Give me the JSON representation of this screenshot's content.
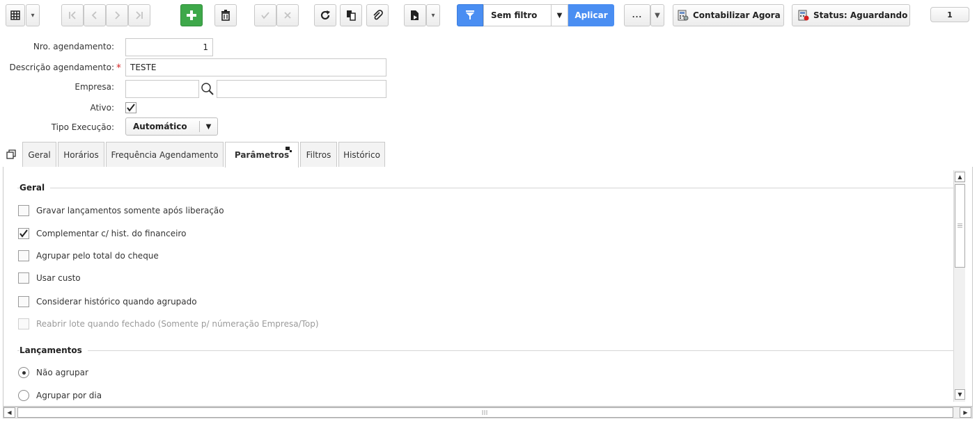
{
  "toolbar": {
    "filter_label": "Sem filtro",
    "apply_label": "Aplicar",
    "more_label": "...",
    "contabilizar_label": "Contabilizar Agora",
    "status_label": "Status: Aguardando",
    "page_number": "1",
    "icons": [
      "grid-icon",
      "first-icon",
      "prev-icon",
      "next-icon",
      "last-icon",
      "plus-icon",
      "trash-icon",
      "check-icon",
      "cancel-icon",
      "refresh-icon",
      "copy-icon",
      "attach-icon",
      "export-icon",
      "filter-icon"
    ]
  },
  "form": {
    "nro_label": "Nro. agendamento:",
    "nro_value": "1",
    "descricao_label": "Descrição agendamento:",
    "descricao_value": "TESTE",
    "empresa_label": "Empresa:",
    "empresa_code": "",
    "empresa_name": "",
    "ativo_label": "Ativo:",
    "ativo_checked": true,
    "tipo_label": "Tipo Execução:",
    "tipo_value": "Automático"
  },
  "tabs": [
    {
      "label": "Geral"
    },
    {
      "label": "Horários"
    },
    {
      "label": "Frequência Agendamento"
    },
    {
      "label": "Parâmetros",
      "active": true
    },
    {
      "label": "Filtros"
    },
    {
      "label": "Histórico"
    }
  ],
  "panel": {
    "geral_title": "Geral",
    "options": [
      {
        "label": "Gravar lançamentos somente após liberação",
        "checked": false,
        "enabled": true
      },
      {
        "label": "Complementar c/ hist. do financeiro",
        "checked": true,
        "enabled": true
      },
      {
        "label": "Agrupar pelo total do cheque",
        "checked": false,
        "enabled": true
      },
      {
        "label": "Usar custo",
        "checked": false,
        "enabled": true
      },
      {
        "label": "Considerar histórico quando agrupado",
        "checked": false,
        "enabled": true
      },
      {
        "label": "Reabrir lote quando fechado (Somente p/ númeração Empresa/Top)",
        "checked": false,
        "enabled": false
      }
    ],
    "lancamentos_title": "Lançamentos",
    "radios": [
      {
        "label": "Não agrupar",
        "selected": true
      },
      {
        "label": "Agrupar por dia",
        "selected": false
      }
    ]
  },
  "colors": {
    "accent_blue": "#4a8ef2",
    "add_green": "#3ea84a",
    "required_red": "#d62a2a"
  }
}
